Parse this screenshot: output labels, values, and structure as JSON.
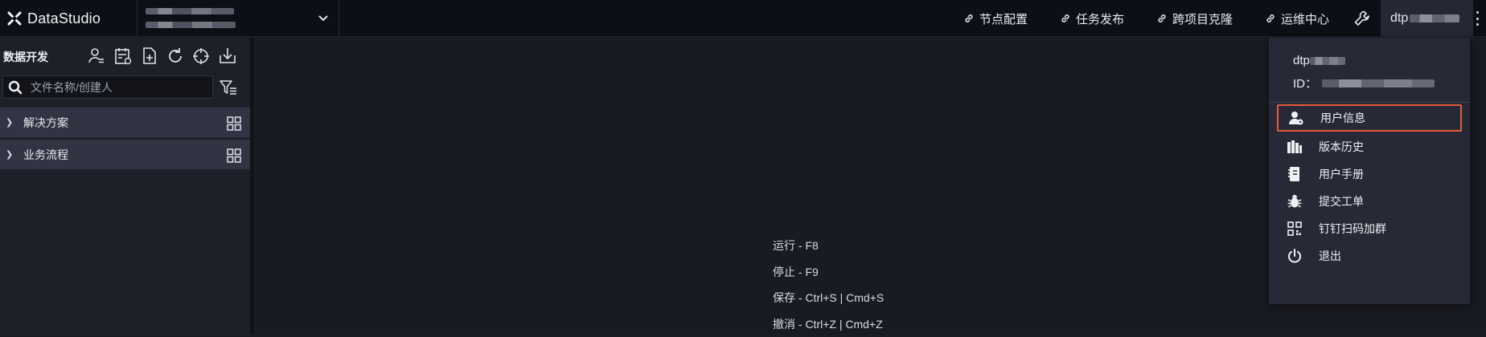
{
  "app": {
    "name": "DataStudio"
  },
  "topnav": {
    "items": [
      {
        "label": "节点配置",
        "icon": "link-icon"
      },
      {
        "label": "任务发布",
        "icon": "link-icon"
      },
      {
        "label": "跨项目克隆",
        "icon": "link-icon"
      },
      {
        "label": "运维中心",
        "icon": "link-icon"
      }
    ],
    "user_label": "dtp"
  },
  "sidebar": {
    "title": "数据开发",
    "search_placeholder": "文件名称/创建人",
    "tree": [
      {
        "label": "解决方案"
      },
      {
        "label": "业务流程"
      }
    ]
  },
  "main": {
    "shortcuts": [
      "运行 - F8",
      "停止 - F9",
      "保存 - Ctrl+S | Cmd+S",
      "撤消 - Ctrl+Z | Cmd+Z"
    ]
  },
  "user_menu": {
    "username": "dtp",
    "id_label": "ID：",
    "items": [
      {
        "label": "用户信息",
        "icon": "user-info-icon",
        "highlighted": true
      },
      {
        "label": "版本历史",
        "icon": "books-icon"
      },
      {
        "label": "用户手册",
        "icon": "manual-icon"
      },
      {
        "label": "提交工单",
        "icon": "bug-icon"
      },
      {
        "label": "钉钉扫码加群",
        "icon": "qr-code-icon"
      },
      {
        "label": "退出",
        "icon": "power-icon"
      }
    ]
  },
  "colors": {
    "accent_highlight": "#e55a3b",
    "topbar_bg": "#0d0f16",
    "panel_bg": "#1d2029"
  }
}
